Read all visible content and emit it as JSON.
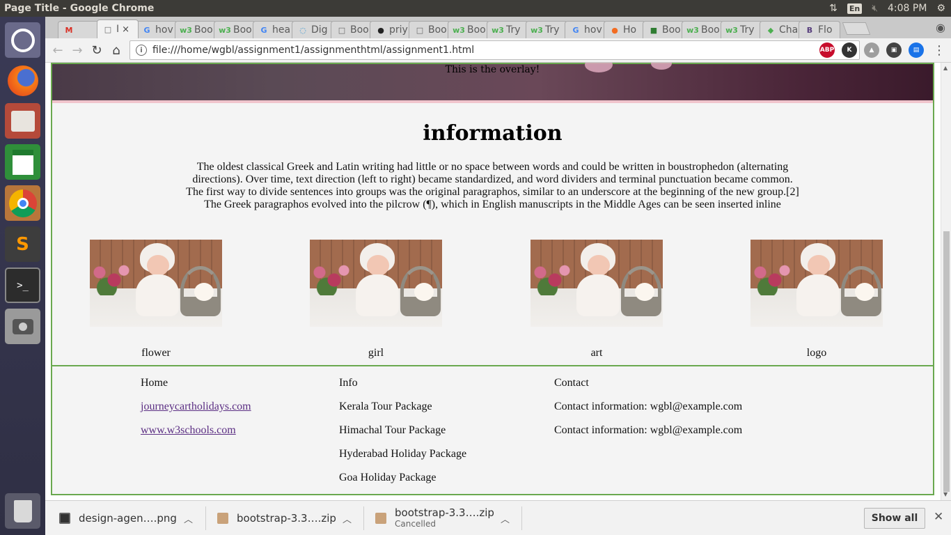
{
  "top_panel": {
    "window_title": "Page Title - Google Chrome",
    "lang": "En",
    "time": "4:08 PM"
  },
  "launcher": {
    "items": [
      "ubuntu-dash",
      "firefox",
      "files",
      "libreoffice-calc",
      "chrome",
      "sublime-text",
      "terminal",
      "screenshot",
      "trash"
    ]
  },
  "tabs": [
    {
      "icon": "M",
      "label": "",
      "icon_color": "#d93025"
    },
    {
      "icon": "□",
      "label": "I",
      "active": true,
      "icon_color": "#666"
    },
    {
      "icon": "G",
      "label": "hov",
      "icon_color": "#4285f4"
    },
    {
      "icon": "w3",
      "label": "Boo",
      "icon_color": "#4caf50"
    },
    {
      "icon": "w3",
      "label": "Boo",
      "icon_color": "#4caf50"
    },
    {
      "icon": "G",
      "label": "hea",
      "icon_color": "#4285f4"
    },
    {
      "icon": "◌",
      "label": "Dig",
      "icon_color": "#2a8fd0"
    },
    {
      "icon": "□",
      "label": "Boo",
      "icon_color": "#666"
    },
    {
      "icon": "●",
      "label": "priy",
      "icon_color": "#222"
    },
    {
      "icon": "□",
      "label": "Boo",
      "icon_color": "#666"
    },
    {
      "icon": "w3",
      "label": "Boo",
      "icon_color": "#4caf50"
    },
    {
      "icon": "w3",
      "label": "Try",
      "icon_color": "#4caf50"
    },
    {
      "icon": "w3",
      "label": "Try",
      "icon_color": "#4caf50"
    },
    {
      "icon": "G",
      "label": "hov",
      "icon_color": "#4285f4"
    },
    {
      "icon": "●",
      "label": "Ho",
      "icon_color": "#f36c21"
    },
    {
      "icon": "■",
      "label": "Boo",
      "icon_color": "#2f7d32"
    },
    {
      "icon": "w3",
      "label": "Boo",
      "icon_color": "#4caf50"
    },
    {
      "icon": "w3",
      "label": "Try",
      "icon_color": "#4caf50"
    },
    {
      "icon": "◆",
      "label": "Cha",
      "icon_color": "#4caf50"
    },
    {
      "icon": "B",
      "label": "Flo",
      "icon_color": "#563d7c"
    }
  ],
  "tab_close_glyph": "×",
  "omnibox": {
    "url": "file:///home/wgbl/assignment1/assignmenthtml/assignment1.html"
  },
  "extensions": [
    {
      "label": "ABP",
      "color": "#c70d2c"
    },
    {
      "label": "K",
      "color": "#333"
    },
    {
      "label": "▲",
      "color": "#9e9e9e"
    },
    {
      "label": "▣",
      "color": "#444"
    },
    {
      "label": "▤",
      "color": "#1a73e8"
    }
  ],
  "page": {
    "overlay_text": "This is the overlay!",
    "info_heading": "information",
    "info_paragraph": "The oldest classical Greek and Latin writing had little or no space between words and could be written in boustrophedon (alternating directions). Over time, text direction (left to right) became standardized, and word dividers and terminal punctuation became common. The first way to divide sentences into groups was the original paragraphos, similar to an underscore at the beginning of the new group.[2] The Greek paragraphos evolved into the pilcrow (¶), which in English manuscripts in the Middle Ages can be seen inserted inline",
    "gallery": [
      {
        "caption": "flower"
      },
      {
        "caption": "girl"
      },
      {
        "caption": "art"
      },
      {
        "caption": "logo"
      }
    ],
    "footer": {
      "col1": [
        "Home",
        "journeycartholidays.com",
        "www.w3schools.com"
      ],
      "col2": [
        "Info",
        "Kerala Tour Package",
        "Himachal Tour Package",
        "Hyderabad Holiday Package",
        "Goa Holiday Package"
      ],
      "col3": [
        "Contact",
        "Contact information: wgbl@example.com",
        "Contact information: wgbl@example.com"
      ]
    }
  },
  "downloads": [
    {
      "name": "design-agen….png",
      "sub": ""
    },
    {
      "name": "bootstrap-3.3….zip",
      "sub": ""
    },
    {
      "name": "bootstrap-3.3….zip",
      "sub": "Cancelled"
    }
  ],
  "show_all_label": "Show all"
}
